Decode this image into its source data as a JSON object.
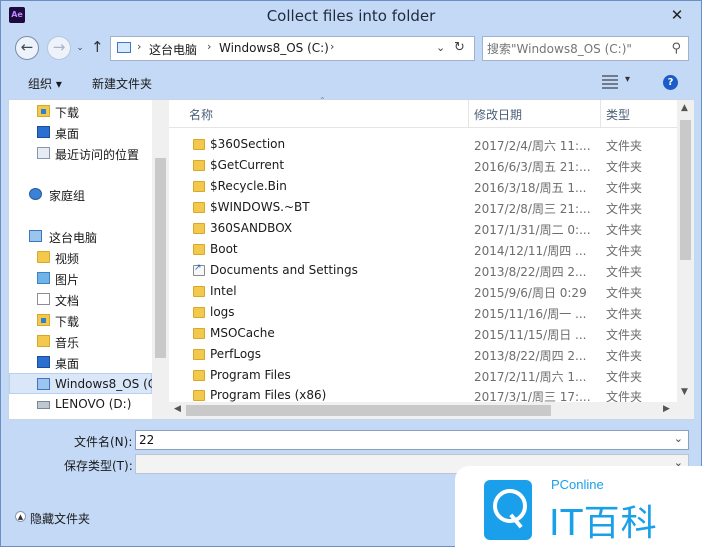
{
  "window": {
    "app_icon": "Ae",
    "title": "Collect files into folder",
    "close_label": "✕"
  },
  "nav": {
    "back_icon": "←",
    "forward_icon": "→",
    "up_icon": "↑",
    "breadcrumbs": [
      "这台电脑",
      "Windows8_OS (C:)"
    ],
    "sep": "›",
    "dropdown_icon": "⌄",
    "refresh_icon": "↻",
    "search_placeholder": "搜索\"Windows8_OS (C:)\"",
    "search_icon": "⚲"
  },
  "toolbar": {
    "organize_label": "组织 ▾",
    "new_folder_label": "新建文件夹",
    "help_label": "?"
  },
  "navpane": {
    "items": [
      {
        "label": "下载",
        "icon": "downloads-folder"
      },
      {
        "label": "桌面",
        "icon": "desktop"
      },
      {
        "label": "最近访问的位置",
        "icon": "recent-places"
      },
      {
        "label": "家庭组",
        "icon": "homegroup"
      },
      {
        "label": "这台电脑",
        "icon": "this-pc"
      },
      {
        "label": "视频",
        "icon": "videos-folder"
      },
      {
        "label": "图片",
        "icon": "pictures-folder"
      },
      {
        "label": "文档",
        "icon": "documents-folder"
      },
      {
        "label": "下载",
        "icon": "downloads-folder"
      },
      {
        "label": "音乐",
        "icon": "music-folder"
      },
      {
        "label": "桌面",
        "icon": "desktop-folder"
      },
      {
        "label": "Windows8_OS (C",
        "icon": "system-drive",
        "selected": true
      },
      {
        "label": "LENOVO (D:)",
        "icon": "drive"
      }
    ]
  },
  "filelist": {
    "columns": {
      "name": "名称",
      "date": "修改日期",
      "type": "类型"
    },
    "rows": [
      {
        "name": "$360Section",
        "date": "2017/2/4/周六 11:...",
        "type": "文件夹"
      },
      {
        "name": "$GetCurrent",
        "date": "2016/6/3/周五 21:...",
        "type": "文件夹"
      },
      {
        "name": "$Recycle.Bin",
        "date": "2016/3/18/周五 1...",
        "type": "文件夹"
      },
      {
        "name": "$WINDOWS.~BT",
        "date": "2017/2/8/周三 21:...",
        "type": "文件夹"
      },
      {
        "name": "360SANDBOX",
        "date": "2017/1/31/周二 0:...",
        "type": "文件夹"
      },
      {
        "name": "Boot",
        "date": "2014/12/11/周四 ...",
        "type": "文件夹"
      },
      {
        "name": "Documents and Settings",
        "date": "2013/8/22/周四 2...",
        "type": "文件夹",
        "shortcut": true
      },
      {
        "name": "Intel",
        "date": "2015/9/6/周日 0:29",
        "type": "文件夹"
      },
      {
        "name": "logs",
        "date": "2015/11/16/周一 ...",
        "type": "文件夹"
      },
      {
        "name": "MSOCache",
        "date": "2015/11/15/周日 ...",
        "type": "文件夹"
      },
      {
        "name": "PerfLogs",
        "date": "2013/8/22/周四 2...",
        "type": "文件夹"
      },
      {
        "name": "Program Files",
        "date": "2017/2/11/周六 1...",
        "type": "文件夹"
      },
      {
        "name": "Program Files (x86)",
        "date": "2017/3/1/周三 17:...",
        "type": "文件夹"
      }
    ]
  },
  "form": {
    "filename_label": "文件名(N):",
    "filename_value": "22",
    "filetype_label": "保存类型(T):",
    "filetype_value": "",
    "hide_folders_label": "隐藏文件夹"
  },
  "watermark": {
    "top_text": "PConline",
    "main_text": "IT百科"
  }
}
